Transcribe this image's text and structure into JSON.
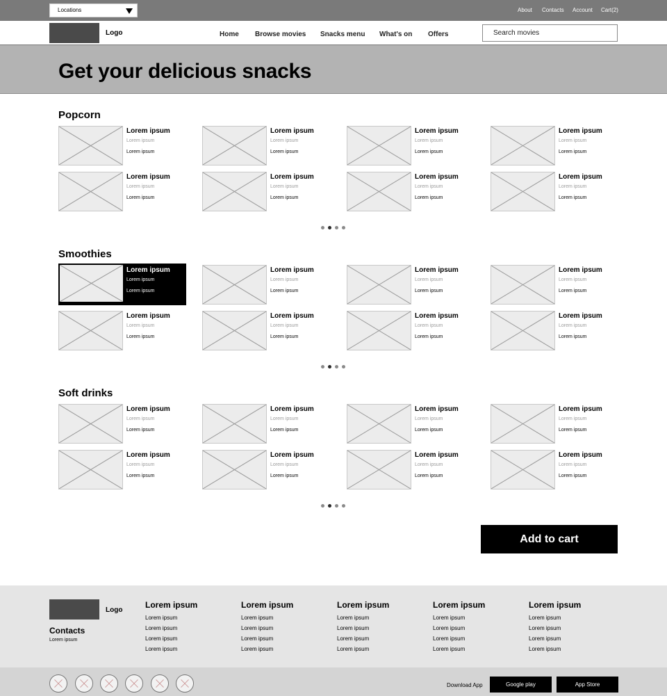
{
  "topbar": {
    "location_select": "Locations",
    "links": [
      "About",
      "Contacts",
      "Account",
      "Cart(2)"
    ]
  },
  "navbar": {
    "logo": "Logo",
    "links": [
      "Home",
      "Browse movies",
      "Snacks menu",
      "What's on",
      "Offers"
    ],
    "search_placeholder": "Search movies"
  },
  "hero": {
    "title": "Get your delicious snacks"
  },
  "sections": [
    {
      "title": "Popcorn",
      "items": [
        {
          "name": "Lorem ipsum",
          "sub": "Lorem ipsum",
          "price": "Lorem ipsum"
        },
        {
          "name": "Lorem ipsum",
          "sub": "Lorem ipsum",
          "price": "Lorem ipsum"
        },
        {
          "name": "Lorem ipsum",
          "sub": "Lorem ipsum",
          "price": "Lorem ipsum"
        },
        {
          "name": "Lorem ipsum",
          "sub": "Lorem ipsum",
          "price": "Lorem ipsum"
        },
        {
          "name": "Lorem ipsum",
          "sub": "Lorem ipsum",
          "price": "Lorem ipsum"
        },
        {
          "name": "Lorem ipsum",
          "sub": "Lorem ipsum",
          "price": "Lorem ipsum"
        },
        {
          "name": "Lorem ipsum",
          "sub": "Lorem ipsum",
          "price": "Lorem ipsum"
        },
        {
          "name": "Lorem ipsum",
          "sub": "Lorem ipsum",
          "price": "Lorem ipsum"
        }
      ],
      "pager": {
        "pages": 4,
        "active": 2
      }
    },
    {
      "title": "Smoothies",
      "items": [
        {
          "name": "Lorem ipsum",
          "sub": "Lorem ipsum",
          "price": "Lorem ipsum",
          "selected": true
        },
        {
          "name": "Lorem ipsum",
          "sub": "Lorem ipsum",
          "price": "Lorem ipsum"
        },
        {
          "name": "Lorem ipsum",
          "sub": "Lorem ipsum",
          "price": "Lorem ipsum"
        },
        {
          "name": "Lorem ipsum",
          "sub": "Lorem ipsum",
          "price": "Lorem ipsum"
        },
        {
          "name": "Lorem ipsum",
          "sub": "Lorem ipsum",
          "price": "Lorem ipsum"
        },
        {
          "name": "Lorem ipsum",
          "sub": "Lorem ipsum",
          "price": "Lorem ipsum"
        },
        {
          "name": "Lorem ipsum",
          "sub": "Lorem ipsum",
          "price": "Lorem ipsum"
        },
        {
          "name": "Lorem ipsum",
          "sub": "Lorem ipsum",
          "price": "Lorem ipsum"
        }
      ],
      "pager": {
        "pages": 4,
        "active": 2
      }
    },
    {
      "title": "Soft drinks",
      "items": [
        {
          "name": "Lorem ipsum",
          "sub": "Lorem ipsum",
          "price": "Lorem ipsum"
        },
        {
          "name": "Lorem ipsum",
          "sub": "Lorem ipsum",
          "price": "Lorem ipsum"
        },
        {
          "name": "Lorem ipsum",
          "sub": "Lorem ipsum",
          "price": "Lorem ipsum"
        },
        {
          "name": "Lorem ipsum",
          "sub": "Lorem ipsum",
          "price": "Lorem ipsum"
        },
        {
          "name": "Lorem ipsum",
          "sub": "Lorem ipsum",
          "price": "Lorem ipsum"
        },
        {
          "name": "Lorem ipsum",
          "sub": "Lorem ipsum",
          "price": "Lorem ipsum"
        },
        {
          "name": "Lorem ipsum",
          "sub": "Lorem ipsum",
          "price": "Lorem ipsum"
        },
        {
          "name": "Lorem ipsum",
          "sub": "Lorem ipsum",
          "price": "Lorem ipsum"
        }
      ],
      "pager": {
        "pages": 4,
        "active": 2
      }
    }
  ],
  "add_to_cart": "Add to cart",
  "footer": {
    "logo": "Logo",
    "contacts_title": "Contacts",
    "contacts_text": "Lorem ipsum",
    "columns": [
      {
        "heading": "Lorem ipsum",
        "links": [
          "Lorem ipsum",
          "Lorem ipsum",
          "Lorem ipsum",
          "Lorem ipsum"
        ]
      },
      {
        "heading": "Lorem ipsum",
        "links": [
          "Lorem ipsum",
          "Lorem ipsum",
          "Lorem ipsum",
          "Lorem ipsum"
        ]
      },
      {
        "heading": "Lorem ipsum",
        "links": [
          "Lorem ipsum",
          "Lorem ipsum",
          "Lorem ipsum",
          "Lorem ipsum"
        ]
      },
      {
        "heading": "Lorem ipsum",
        "links": [
          "Lorem ipsum",
          "Lorem ipsum",
          "Lorem ipsum",
          "Lorem ipsum"
        ]
      },
      {
        "heading": "Lorem ipsum",
        "links": [
          "Lorem ipsum",
          "Lorem ipsum",
          "Lorem ipsum",
          "Lorem ipsum"
        ]
      }
    ],
    "social_icons": [
      "social-icon-1",
      "social-icon-2",
      "social-icon-3",
      "social-icon-4",
      "social-icon-5",
      "social-icon-6"
    ],
    "download_label": "Download App",
    "google_play": "Google play",
    "app_store": "App Store"
  },
  "colors": {
    "topbar": "#7a7a7a",
    "hero": "#b3b3b3",
    "footer": "#e5e5e5",
    "bottombar": "#d4d4d4",
    "accent": "#000000"
  }
}
